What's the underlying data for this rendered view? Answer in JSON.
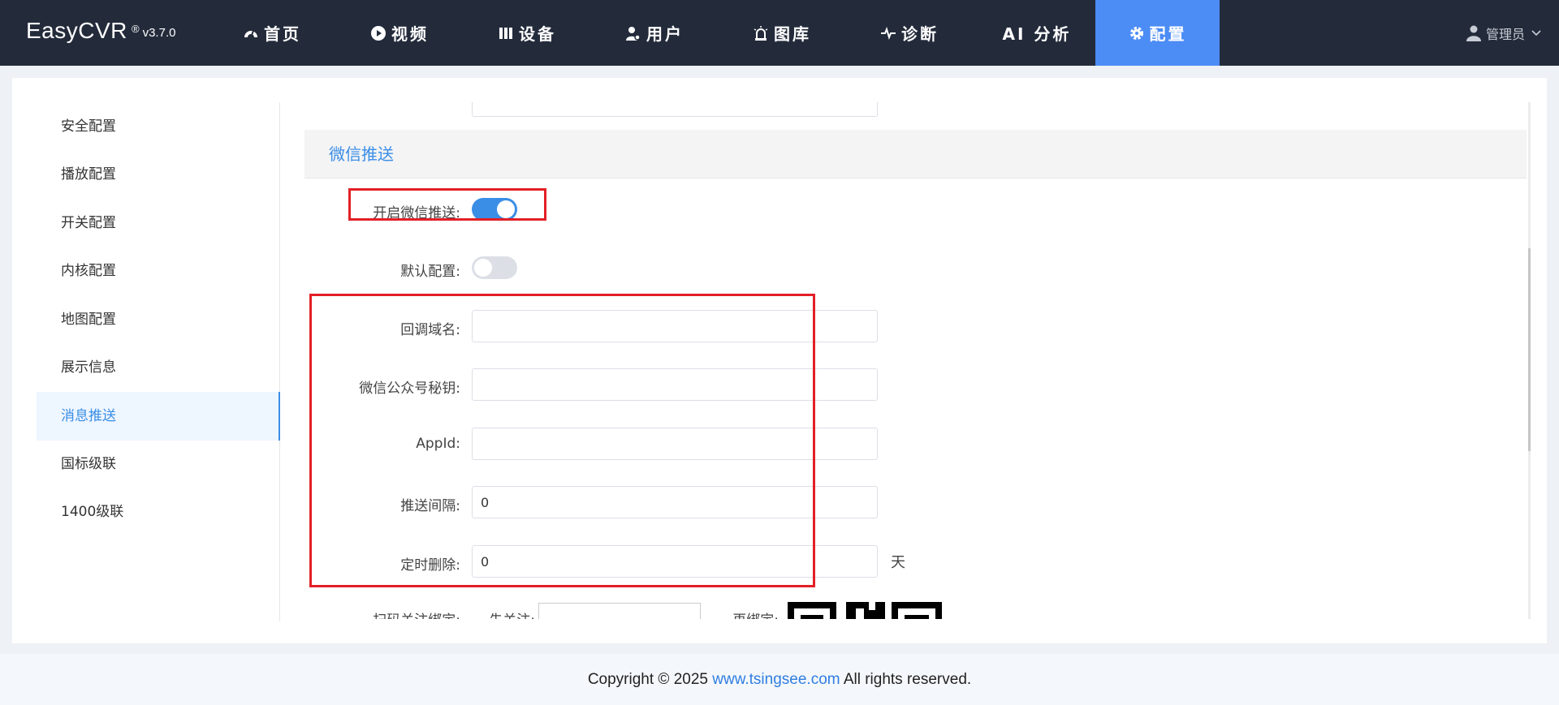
{
  "app": {
    "brand": "EasyCVR",
    "version_mark": "®",
    "version": "v3.7.0"
  },
  "nav": [
    {
      "label": "首页",
      "icon": "dashboard-icon"
    },
    {
      "label": "视频",
      "icon": "play-icon"
    },
    {
      "label": "设备",
      "icon": "device-icon"
    },
    {
      "label": "用户",
      "icon": "user-gear-icon"
    },
    {
      "label": "图库",
      "icon": "alarm-icon"
    },
    {
      "label": "诊断",
      "icon": "pulse-icon"
    },
    {
      "label": "AI 分析",
      "icon": ""
    },
    {
      "label": "配置",
      "icon": "gear-icon",
      "active": true
    }
  ],
  "user": {
    "name": "管理员"
  },
  "sidebar": {
    "items": [
      {
        "label": "安全配置"
      },
      {
        "label": "播放配置"
      },
      {
        "label": "开关配置"
      },
      {
        "label": "内核配置"
      },
      {
        "label": "地图配置"
      },
      {
        "label": "展示信息"
      },
      {
        "label": "消息推送",
        "active": true
      },
      {
        "label": "国标级联"
      },
      {
        "label": "1400级联"
      }
    ]
  },
  "section": {
    "title": "微信推送"
  },
  "form": {
    "enable_wechat": {
      "label": "开启微信推送:",
      "on": true
    },
    "default_config": {
      "label": "默认配置:",
      "on": false
    },
    "callback_domain": {
      "label": "回调域名:",
      "value": ""
    },
    "wechat_secret": {
      "label": "微信公众号秘钥:",
      "value": ""
    },
    "appid": {
      "label": "AppId:",
      "value": ""
    },
    "push_interval": {
      "label": "推送间隔:",
      "value": "0"
    },
    "auto_delete": {
      "label": "定时删除:",
      "value": "0",
      "unit": "天"
    },
    "scan_bind": {
      "label": "扫码关注绑定:",
      "follow_label": "先关注:",
      "bind_label": "再绑定:"
    }
  },
  "footer": {
    "prefix": "Copyright © 2025 ",
    "link": "www.tsingsee.com",
    "suffix": " All rights reserved."
  },
  "colors": {
    "header_bg": "#232b3b",
    "accent": "#4c8cf5",
    "highlight": "#e31f26"
  }
}
